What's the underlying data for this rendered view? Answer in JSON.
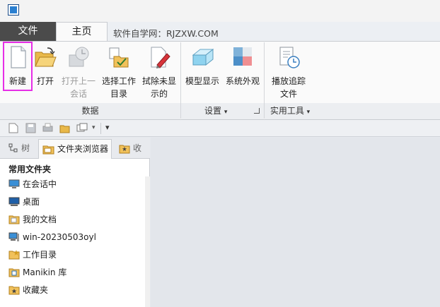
{
  "tabs": {
    "file": "文件",
    "home": "主页"
  },
  "watermark": "软件自学网：RJZXW.COM",
  "ribbon": {
    "buttons": [
      {
        "label": "新建",
        "icon": "new-file-icon"
      },
      {
        "label": "打开",
        "icon": "open-folder-icon"
      },
      {
        "label": "打开上一\n会话",
        "icon": "open-last-session-icon"
      },
      {
        "label": "选择工作\n目录",
        "icon": "select-working-dir-icon"
      },
      {
        "label": "拭除未显\n示的",
        "icon": "erase-not-displayed-icon"
      },
      {
        "label": "模型显示",
        "icon": "model-display-icon"
      },
      {
        "label": "系统外观",
        "icon": "system-appearance-icon"
      },
      {
        "label": "播放追踪\n文件",
        "icon": "play-trail-file-icon"
      }
    ],
    "groups": {
      "data": "数据",
      "settings": "设置",
      "utilities": "实用工具"
    },
    "dropdown_glyph": "▾"
  },
  "navigator": {
    "tabs": [
      "树",
      "文件夹浏览器",
      "收"
    ],
    "section_title": "常用文件夹",
    "items": [
      {
        "label": "在会话中",
        "icon": "in-session-icon"
      },
      {
        "label": "桌面",
        "icon": "desktop-icon"
      },
      {
        "label": "我的文档",
        "icon": "my-documents-icon"
      },
      {
        "label": "win-20230503oyl",
        "icon": "computer-icon"
      },
      {
        "label": "工作目录",
        "icon": "working-directory-icon"
      },
      {
        "label": "Manikin 库",
        "icon": "manikin-library-icon"
      },
      {
        "label": "收藏夹",
        "icon": "favorites-icon"
      }
    ]
  }
}
